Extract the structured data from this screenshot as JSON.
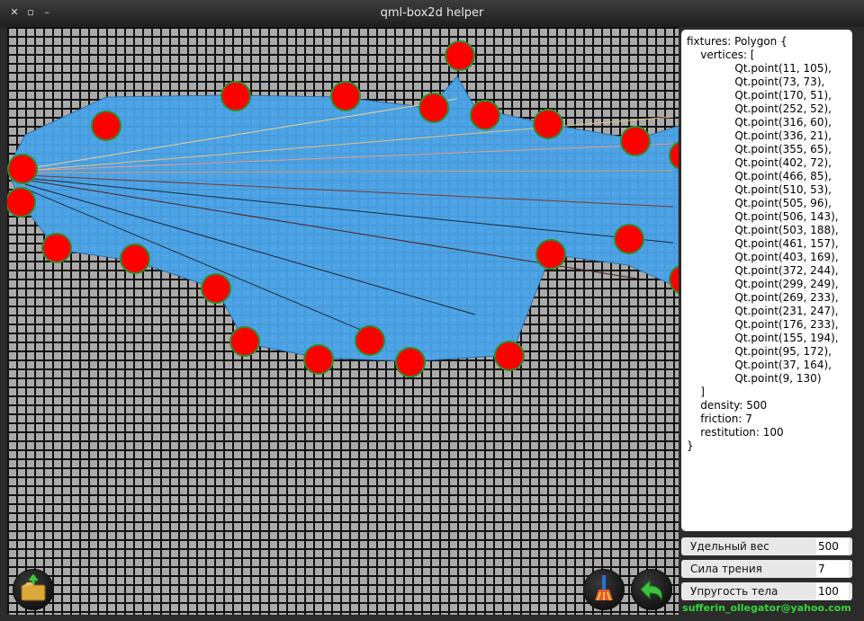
{
  "window": {
    "title": "qml-box2d helper"
  },
  "code": {
    "lines": [
      "fixtures: Polygon {",
      "    vertices: [",
      "              Qt.point(11, 105),",
      "              Qt.point(73, 73),",
      "              Qt.point(170, 51),",
      "              Qt.point(252, 52),",
      "              Qt.point(316, 60),",
      "              Qt.point(336, 21),",
      "              Qt.point(355, 65),",
      "              Qt.point(402, 72),",
      "              Qt.point(466, 85),",
      "              Qt.point(510, 53),",
      "              Qt.point(505, 96),",
      "              Qt.point(506, 143),",
      "              Qt.point(503, 188),",
      "              Qt.point(461, 157),",
      "              Qt.point(403, 169),",
      "              Qt.point(372, 244),",
      "              Qt.point(299, 249),",
      "              Qt.point(269, 233),",
      "              Qt.point(231, 247),",
      "              Qt.point(176, 233),",
      "              Qt.point(155, 194),",
      "              Qt.point(95, 172),",
      "              Qt.point(37, 164),",
      "              Qt.point(9, 130)",
      "    ]",
      "    density: 500",
      "    friction: 7",
      "    restitution: 100",
      "}"
    ]
  },
  "fields": {
    "density": {
      "label": "Удельный вес",
      "value": "500"
    },
    "friction": {
      "label": "Сила трения",
      "value": "7"
    },
    "restitution": {
      "label": "Упругость тела",
      "value": "100"
    }
  },
  "footer": {
    "email": "sufferin_ollegator@yahoo.com"
  },
  "icons": {
    "open": "folder-open-icon",
    "clear": "broom-icon",
    "undo": "undo-arrow-icon"
  },
  "colors": {
    "vertex": "#ff0000",
    "vertex_border": "#2e8b2e",
    "body": "#4aa3e8",
    "grid_bg": "#aaaaaa"
  }
}
